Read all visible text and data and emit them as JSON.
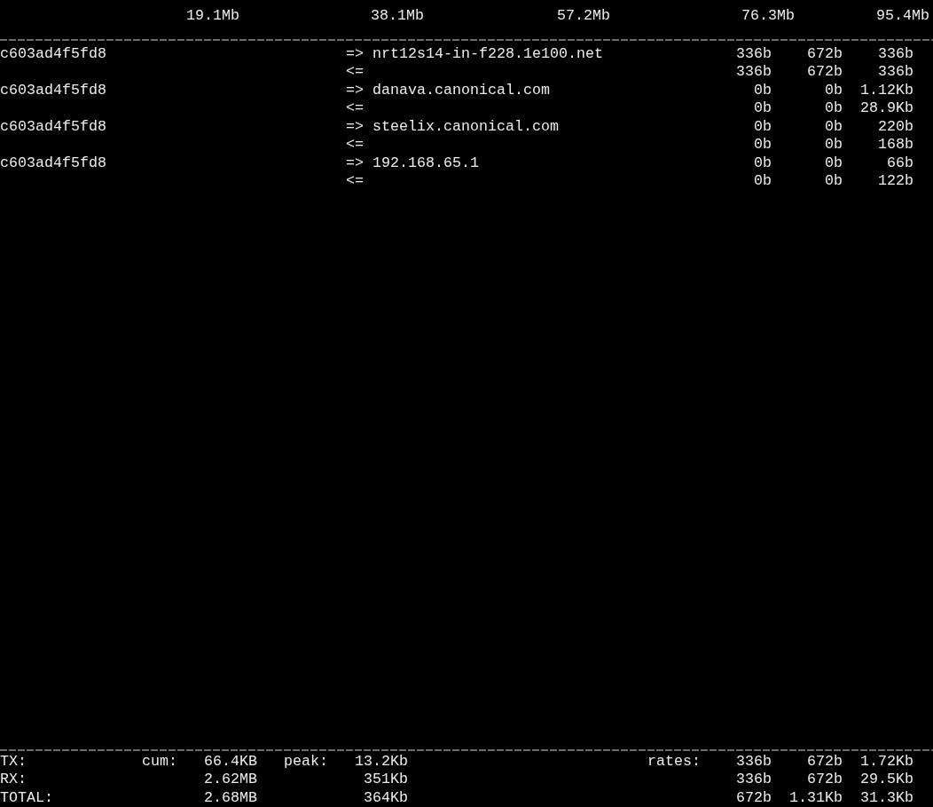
{
  "scale": [
    "19.1Mb",
    "38.1Mb",
    "57.2Mb",
    "76.3Mb",
    "95.4Mb"
  ],
  "connections": [
    {
      "host": "c603ad4f5fd8",
      "send_arrow": "=>",
      "remote": "nrt12s14-in-f228.1e100.net",
      "sent_rates": [
        "336b",
        "672b",
        "336b"
      ],
      "receive_arrow": "<=",
      "received_rates": [
        "336b",
        "672b",
        "336b"
      ]
    },
    {
      "host": "c603ad4f5fd8",
      "send_arrow": "=>",
      "remote": "danava.canonical.com",
      "sent_rates": [
        "0b",
        "0b",
        "1.12Kb"
      ],
      "receive_arrow": "<=",
      "received_rates": [
        "0b",
        "0b",
        "28.9Kb"
      ]
    },
    {
      "host": "c603ad4f5fd8",
      "send_arrow": "=>",
      "remote": "steelix.canonical.com",
      "sent_rates": [
        "0b",
        "0b",
        "220b"
      ],
      "receive_arrow": "<=",
      "received_rates": [
        "0b",
        "0b",
        "168b"
      ]
    },
    {
      "host": "c603ad4f5fd8",
      "send_arrow": "=>",
      "remote": "192.168.65.1",
      "sent_rates": [
        "0b",
        "0b",
        "66b"
      ],
      "receive_arrow": "<=",
      "received_rates": [
        "0b",
        "0b",
        "122b"
      ]
    }
  ],
  "totals": [
    {
      "label": "TX:",
      "cum_label": "cum:",
      "cum": "66.4KB",
      "peak_label": "peak:",
      "peak": "13.2Kb",
      "rates_label": "rates:",
      "rates": [
        "336b",
        "672b",
        "1.72Kb"
      ]
    },
    {
      "label": "RX:",
      "cum": "2.62MB",
      "peak": "351Kb",
      "rates": [
        "336b",
        "672b",
        "29.5Kb"
      ]
    },
    {
      "label": "TOTAL:",
      "cum": "2.68MB",
      "peak": "364Kb",
      "rates": [
        "672b",
        "1.31Kb",
        "31.3Kb"
      ]
    }
  ]
}
